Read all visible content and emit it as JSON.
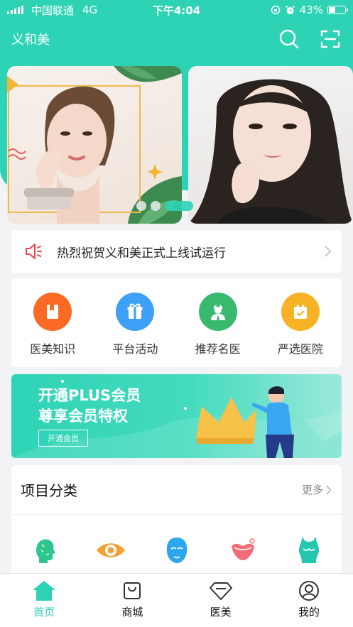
{
  "status_bar": {
    "carrier": "中国联通",
    "network": "4G",
    "time": "下午4:04",
    "battery": "43%",
    "battery_level": 0.43
  },
  "app_bar": {
    "title": "义和美"
  },
  "notice": {
    "text": "热烈祝贺义和美正式上线试运行"
  },
  "quick_nav": [
    {
      "label": "医美知识",
      "icon": "book-icon",
      "color": "#fa6a24"
    },
    {
      "label": "平台活动",
      "icon": "gift-icon",
      "color": "#3ea0f7"
    },
    {
      "label": "推荐名医",
      "icon": "doctor-icon",
      "color": "#38b96e"
    },
    {
      "label": "严选医院",
      "icon": "calendar-check-icon",
      "color": "#f7b325"
    }
  ],
  "promo": {
    "line1": "开通PLUS会员",
    "line2": "尊享会员特权",
    "button": "开通会员"
  },
  "categories": {
    "title": "项目分类",
    "more": "更多",
    "items": [
      {
        "icon": "face-profile-icon"
      },
      {
        "icon": "eye-icon"
      },
      {
        "icon": "face-mask-icon"
      },
      {
        "icon": "lips-icon"
      },
      {
        "icon": "body-icon"
      }
    ]
  },
  "tabbar": [
    {
      "label": "首页",
      "icon": "home-icon",
      "active": true
    },
    {
      "label": "商城",
      "icon": "shop-bag-icon",
      "active": false
    },
    {
      "label": "医美",
      "icon": "diamond-icon",
      "active": false
    },
    {
      "label": "我的",
      "icon": "user-icon",
      "active": false
    }
  ],
  "colors": {
    "accent": "#2ed3b6",
    "speaker": "#e5474d"
  }
}
